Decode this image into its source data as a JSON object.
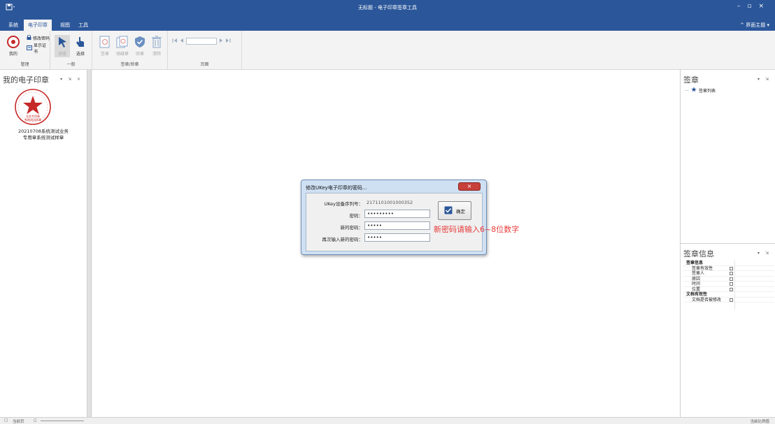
{
  "window": {
    "title": "无标题 - 电子印章签章工具",
    "minimize": "–",
    "maximize": "▫",
    "close": "×"
  },
  "menu": {
    "tabs": [
      "系统",
      "电子印章",
      "视图",
      "工具"
    ],
    "active_tab": "电子印章",
    "theme_label": "^ 界面主题 ▾"
  },
  "ribbon": {
    "groups": {
      "manage": {
        "label": "管理",
        "my_button": "我的",
        "change_password": "修改密码",
        "show_cert": "显示证书"
      },
      "general": {
        "label": "一般",
        "browse_button": "浏览",
        "select_button": "选择"
      },
      "sign_verify": {
        "label": "签章/验章",
        "sign": "签章",
        "riding_seal": "骑缝章",
        "verify": "验章",
        "clear": "清除"
      },
      "page": {
        "label": "页面",
        "page_value": ""
      }
    }
  },
  "left_panel": {
    "title": "我的电子印章",
    "controls": "▾ ⇲ ×",
    "seal": {
      "caption_line1": "20210708系统测试业务",
      "caption_line2": "专用章系统测试样章",
      "inner_text_1": "业务专用章",
      "inner_text_2": "系统测试样章"
    }
  },
  "right_panel_top": {
    "title": "签章",
    "controls": "▾ ⇲",
    "tree_item": "签章列表"
  },
  "right_panel_bottom": {
    "title": "签章信息",
    "controls": "▾ ⇲",
    "rows": [
      {
        "label": "签章信息",
        "category": true
      },
      {
        "label": "签章有效性",
        "category": false
      },
      {
        "label": "签章人",
        "category": false
      },
      {
        "label": "原因",
        "category": false
      },
      {
        "label": "时间",
        "category": false
      },
      {
        "label": "位置",
        "category": false
      },
      {
        "label": "文档有效性",
        "category": true
      },
      {
        "label": "文档是否被修改",
        "category": false
      }
    ]
  },
  "status_bar": {
    "current_page": "当前页",
    "right_text": "当前比例值"
  },
  "dialog": {
    "title": "修改UKey电子印章的密码...",
    "close_glyph": "×",
    "serial_label": "UKey设备序列号：",
    "serial_value": "2171101001000352",
    "password_label": "密码：",
    "password_value": "•••••••••",
    "new_password_label": "新的密码：",
    "new_password_value": "•••••",
    "confirm_password_label": "再次输入新的密码：",
    "confirm_password_value": "•••••",
    "ok_button": "确定"
  },
  "annotation": {
    "hint": "新密码请输入6~8位数字",
    "color": "#e83a3a"
  }
}
